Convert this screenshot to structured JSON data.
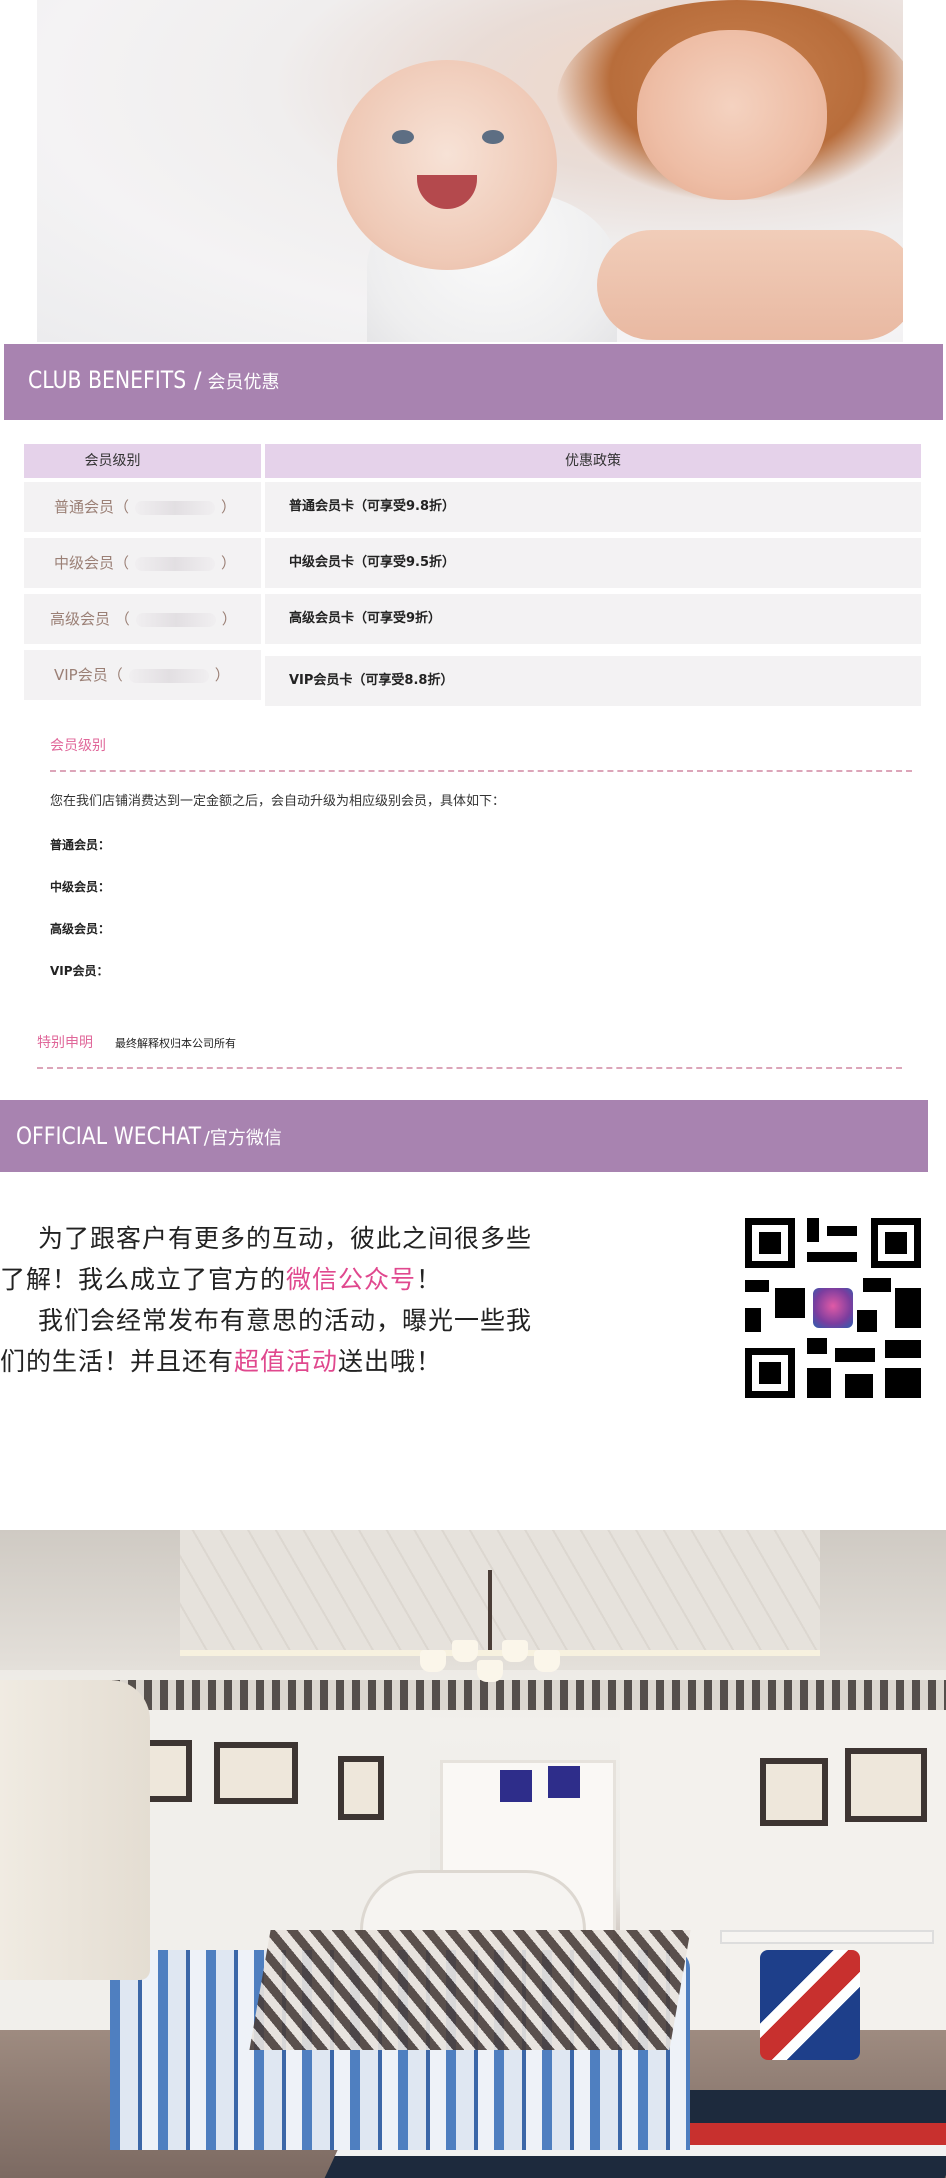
{
  "hero": {
    "alt": "mother and baby photo"
  },
  "club": {
    "title_en": "CLUB BENEFITS",
    "slash": "/",
    "title_cn": "会员优惠",
    "col_level": "会员级别",
    "col_policy": "优惠政策",
    "rows": [
      {
        "level": "普通会员（",
        "close": "）",
        "policy": "普通会员卡（可享受9.8折）"
      },
      {
        "level": "中级会员（",
        "close": "）",
        "policy": "中级会员卡（可享受9.5折）"
      },
      {
        "level": "高级会员 （",
        "close": "）",
        "policy": "高级会员卡（可享受9折）"
      },
      {
        "level": "VIP会员（",
        "close": "）",
        "policy": "VIP会员卡（可享受8.8折）"
      }
    ]
  },
  "levels": {
    "heading": "会员级别",
    "intro": "您在我们店铺消费达到一定金额之后，会自动升级为相应级别会员，具体如下：",
    "items": [
      "普通会员：",
      "中级会员：",
      "高级会员：",
      "VIP会员："
    ]
  },
  "notice": {
    "heading": "特别申明",
    "text": "最终解释权归本公司所有"
  },
  "wechat": {
    "title_en": "OFFICIAL WECHAT",
    "title_cn": "/官方微信",
    "p1_a": "为了跟客户有更多的互动，彼此之间很多些",
    "p1_b": "了解！我么成立了官方的",
    "p1_hl": "微信公众号",
    "p1_c": "！",
    "p2_a": "我们会经常发布有意思的活动，曝光一些我",
    "p2_b": "们的生活！并且还有",
    "p2_hl": "超值活动",
    "p2_c": "送出哦！",
    "qr_icon": "qr-code-icon"
  },
  "colors": {
    "bar": "#a883b0",
    "table_head": "#e5d2ea",
    "pink": "#e0679a",
    "highlight": "#e0488e"
  }
}
